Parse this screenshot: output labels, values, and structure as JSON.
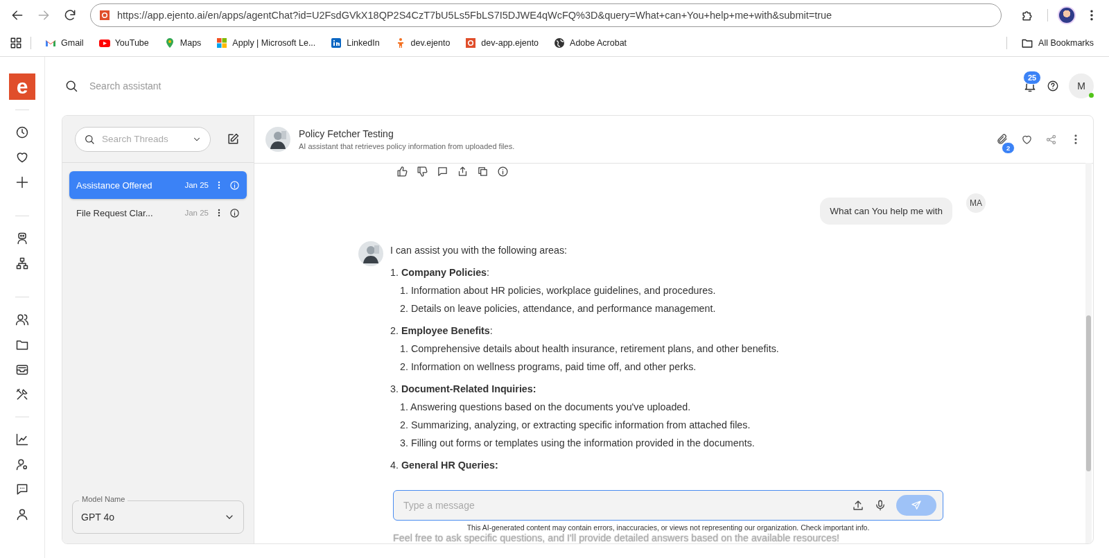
{
  "browser": {
    "url": "https://app.ejento.ai/en/apps/agentChat?id=U2FsdGVkX18QP2S4CzT7bU5Ls5FbLS7I5DJWE4qWcFQ%3D&query=What+can+You+help+me+with&submit=true",
    "bookmarks": [
      {
        "label": "Gmail",
        "kind": "gmail"
      },
      {
        "label": "YouTube",
        "kind": "youtube"
      },
      {
        "label": "Maps",
        "kind": "maps"
      },
      {
        "label": "Apply | Microsoft Le...",
        "kind": "windows"
      },
      {
        "label": "LinkedIn",
        "kind": "linkedin"
      },
      {
        "label": "dev.ejento",
        "kind": "person"
      },
      {
        "label": "dev-app.ejento",
        "kind": "ejento"
      },
      {
        "label": "Adobe Acrobat",
        "kind": "globe"
      }
    ],
    "all_bookmarks": "All Bookmarks"
  },
  "brand": {
    "letter": "e"
  },
  "search": {
    "placeholder": "Search assistant"
  },
  "notifications": {
    "count": "25"
  },
  "user": {
    "initial": "M",
    "online": true
  },
  "threads": {
    "search_placeholder": "Search Threads",
    "items": [
      {
        "title": "Assistance Offered",
        "date": "Jan 25",
        "selected": true
      },
      {
        "title": "File Request Clar...",
        "date": "Jan 25",
        "selected": false
      }
    ],
    "model": {
      "label": "Model Name",
      "value": "GPT 4o"
    }
  },
  "chat": {
    "title": "Policy Fetcher Testing",
    "subtitle": "AI assistant that retrieves policy information from uploaded files.",
    "attachments": "2",
    "user_message": {
      "text": "What can You help me with",
      "avatar": "MA"
    },
    "reply": {
      "intro": "I can assist you with the following areas:",
      "sections": [
        {
          "marker": "1.",
          "title": "**Company Policies**:",
          "items": [
            {
              "marker": "1.",
              "text": "Information about HR policies, workplace guidelines, and procedures."
            },
            {
              "marker": "2.",
              "text": "Details on leave policies, attendance, and performance management."
            }
          ]
        },
        {
          "marker": "2.",
          "title": "**Employee Benefits**:",
          "items": [
            {
              "marker": "1.",
              "text": "Comprehensive details about health insurance, retirement plans, and other benefits."
            },
            {
              "marker": "2.",
              "text": "Information on wellness programs, paid time off, and other perks."
            }
          ]
        },
        {
          "marker": "3.",
          "title": "**Document-Related Inquiries:**",
          "items": [
            {
              "marker": "1.",
              "text": "Answering questions based on the documents you've uploaded."
            },
            {
              "marker": "2.",
              "text": "Summarizing, analyzing, or extracting specific information from attached files."
            },
            {
              "marker": "3.",
              "text": "Filling out forms or templates using the information provided in the documents."
            }
          ]
        },
        {
          "marker": "4.",
          "title": "**General HR Queries:**"
        }
      ],
      "closing": "Feel free to ask specific questions, and I'll provide detailed answers based on the available resources!"
    },
    "input": {
      "placeholder": "Type a message"
    },
    "disclaimer": "This AI-generated content may contain errors, inaccuracies, or views not representing our organization. Check important info."
  }
}
